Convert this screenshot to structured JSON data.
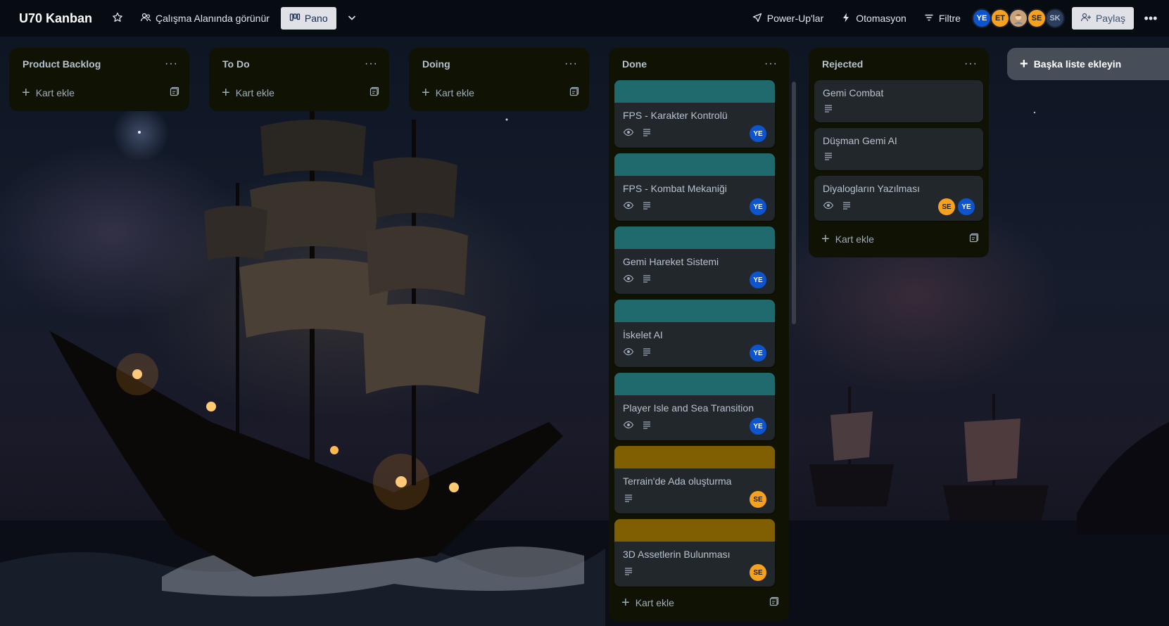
{
  "header": {
    "board_title": "U70 Kanban",
    "visibility_label": "Çalışma Alanında görünür",
    "view_label": "Pano",
    "powerups_label": "Power-Up'lar",
    "automation_label": "Otomasyon",
    "filter_label": "Filtre",
    "share_label": "Paylaş",
    "members": [
      {
        "initials": "YE",
        "color": "#0c55cf"
      },
      {
        "initials": "ET",
        "color": "#f8a11e"
      },
      {
        "initials": "",
        "color": "#c9a27a"
      },
      {
        "initials": "SE",
        "color": "#f8a11e"
      },
      {
        "initials": "SK",
        "color": "#2c3e5d"
      }
    ]
  },
  "lists": [
    {
      "title": "Product Backlog",
      "add_label": "Kart ekle"
    },
    {
      "title": "To Do",
      "add_label": "Kart ekle"
    },
    {
      "title": "Doing",
      "add_label": "Kart ekle"
    },
    {
      "title": "Done",
      "add_label": "Kart ekle",
      "cards": [
        {
          "title": "FPS - Karakter Kontrolü",
          "cover": "#206a6e",
          "members": [
            "YE"
          ]
        },
        {
          "title": "FPS - Kombat Mekaniği",
          "cover": "#206a6e",
          "members": [
            "YE"
          ]
        },
        {
          "title": "Gemi Hareket Sistemi",
          "cover": "#206a6e",
          "members": [
            "YE"
          ]
        },
        {
          "title": "İskelet AI",
          "cover": "#206a6e",
          "members": [
            "YE"
          ]
        },
        {
          "title": "Player Isle and Sea Transition",
          "cover": "#206a6e",
          "members": [
            "YE"
          ]
        },
        {
          "title": "Terrain'de Ada oluşturma",
          "cover": "#7f5f01",
          "members": [
            "SE"
          ]
        },
        {
          "title": "3D Assetlerin Bulunması",
          "cover": "#7f5f01",
          "members": [
            "SE"
          ]
        }
      ]
    },
    {
      "title": "Rejected",
      "add_label": "Kart ekle",
      "cards": [
        {
          "title": "Gemi Combat",
          "members": []
        },
        {
          "title": "Düşman Gemi AI",
          "members": []
        },
        {
          "title": "Diyalogların Yazılması",
          "members": [
            "SE",
            "YE"
          ]
        }
      ]
    }
  ],
  "add_list_label": "Başka liste ekleyin"
}
